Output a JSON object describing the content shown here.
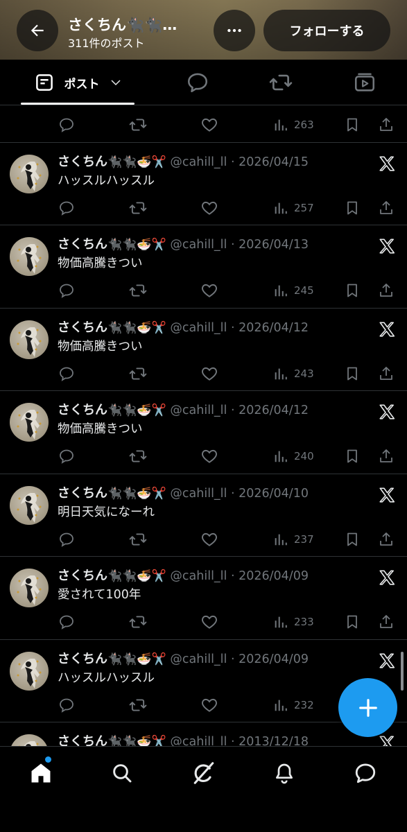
{
  "header": {
    "title": "さくちん🐈‍⬛🐈‍⬛…",
    "subtitle": "311件のポスト",
    "follow_label": "フォローする"
  },
  "tabs": {
    "posts_label": "ポスト",
    "items": [
      "posts-tab",
      "replies-tab",
      "retweets-tab",
      "media-tab"
    ]
  },
  "top_partial": {
    "views": "263"
  },
  "posts": [
    {
      "name": "さくちん",
      "emoji": "🐈‍⬛🐈‍⬛🍜✂️",
      "handle": "@cahill_ll · 2026/04/15",
      "text": "ハッスルハッスル",
      "views": "257"
    },
    {
      "name": "さくちん",
      "emoji": "🐈‍⬛🐈‍⬛🍜✂️",
      "handle": "@cahill_ll · 2026/04/13",
      "text": "物価高騰きつい",
      "views": "245"
    },
    {
      "name": "さくちん",
      "emoji": "🐈‍⬛🐈‍⬛🍜✂️",
      "handle": "@cahill_ll · 2026/04/12",
      "text": "物価高騰きつい",
      "views": "243"
    },
    {
      "name": "さくちん",
      "emoji": "🐈‍⬛🐈‍⬛🍜✂️",
      "handle": "@cahill_ll · 2026/04/12",
      "text": "物価高騰きつい",
      "views": "240"
    },
    {
      "name": "さくちん",
      "emoji": "🐈‍⬛🐈‍⬛🍜✂️",
      "handle": "@cahill_ll · 2026/04/10",
      "text": "明日天気になーれ",
      "views": "237"
    },
    {
      "name": "さくちん",
      "emoji": "🐈‍⬛🐈‍⬛🍜✂️",
      "handle": "@cahill_ll · 2026/04/09",
      "text": "愛されて100年",
      "views": "233"
    },
    {
      "name": "さくちん",
      "emoji": "🐈‍⬛🐈‍⬛🍜✂️",
      "handle": "@cahill_ll · 2026/04/09",
      "text": "ハッスルハッスル",
      "views": "232"
    },
    {
      "name": "さくちん",
      "emoji": "🐈‍⬛🐈‍⬛🍜✂️",
      "handle": "@cahill_ll · 2013/12/18",
      "text": "",
      "views": ""
    }
  ],
  "colors": {
    "accent": "#1d9bf0",
    "muted": "#71767b",
    "divider": "#2f3336"
  },
  "nav": [
    "home-icon",
    "search-icon",
    "grok-icon",
    "bell-icon",
    "messages-icon"
  ]
}
